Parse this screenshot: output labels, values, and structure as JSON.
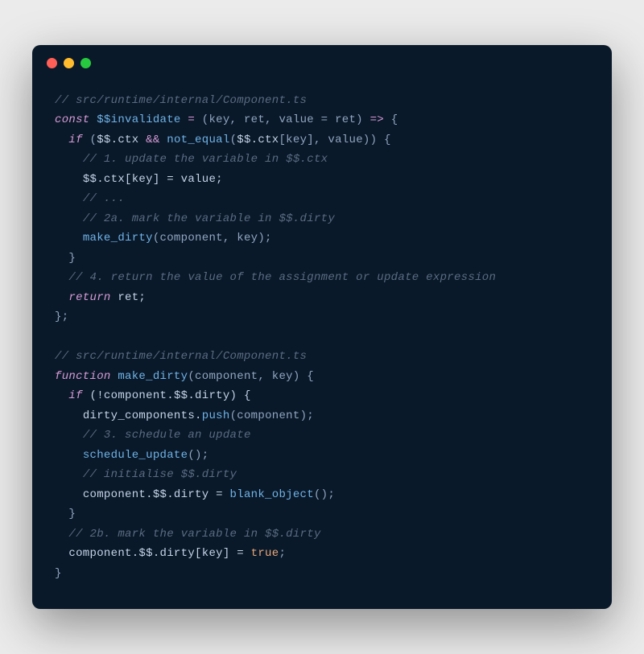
{
  "colors": {
    "bg": "#0a1929",
    "comment": "#5a6b82",
    "keyword": "#d69bd6",
    "function": "#6fb3e8",
    "text": "#c5d3e8",
    "bool": "#e8a77a"
  },
  "code": {
    "c1": "// src/runtime/internal/Component.ts",
    "l2_const": "const",
    "l2_name": "$$invalidate",
    "l2_eq": " = ",
    "l2_params": "(key, ret, value = ret)",
    "l2_arrow": " => ",
    "l2_brace": "{",
    "l3_if": "if",
    "l3_open": " (",
    "l3_a": "$$.",
    "l3_ctx": "ctx",
    "l3_and": " && ",
    "l3_fn": "not_equal",
    "l3_open2": "(",
    "l3_b": "$$.",
    "l3_ctx2": "ctx",
    "l3_br": "[key], value)) {",
    "c4": "// 1. update the variable in $$.ctx",
    "l5_a": "$$.",
    "l5_ctx": "ctx",
    "l5_b": "[key] = value;",
    "c6": "// ...",
    "c7": "// 2a. mark the variable in $$.dirty",
    "l8_fn": "make_dirty",
    "l8_args": "(component, key);",
    "l9": "}",
    "c10": "// 4. return the value of the assignment or update expression",
    "l11_ret": "return",
    "l11_val": " ret;",
    "l12": "};",
    "c13": "// src/runtime/internal/Component.ts",
    "l14_func": "function",
    "l14_name": " make_dirty",
    "l14_params": "(component, key) {",
    "l15_if": "if",
    "l15_cond": " (!component.",
    "l15_dd": "$$",
    "l15_dirty": ".dirty) {",
    "l16_a": "dirty_components.",
    "l16_push": "push",
    "l16_b": "(component);",
    "c17": "// 3. schedule an update",
    "l18_fn": "schedule_update",
    "l18_call": "();",
    "c19": "// initialise $$.dirty",
    "l20_a": "component.",
    "l20_dd": "$$",
    "l20_b": ".dirty = ",
    "l20_fn": "blank_object",
    "l20_c": "();",
    "l21": "}",
    "c22": "// 2b. mark the variable in $$.dirty",
    "l23_a": "component.",
    "l23_dd": "$$",
    "l23_b": ".dirty[key] = ",
    "l23_true": "true",
    "l23_c": ";",
    "l24": "}"
  }
}
